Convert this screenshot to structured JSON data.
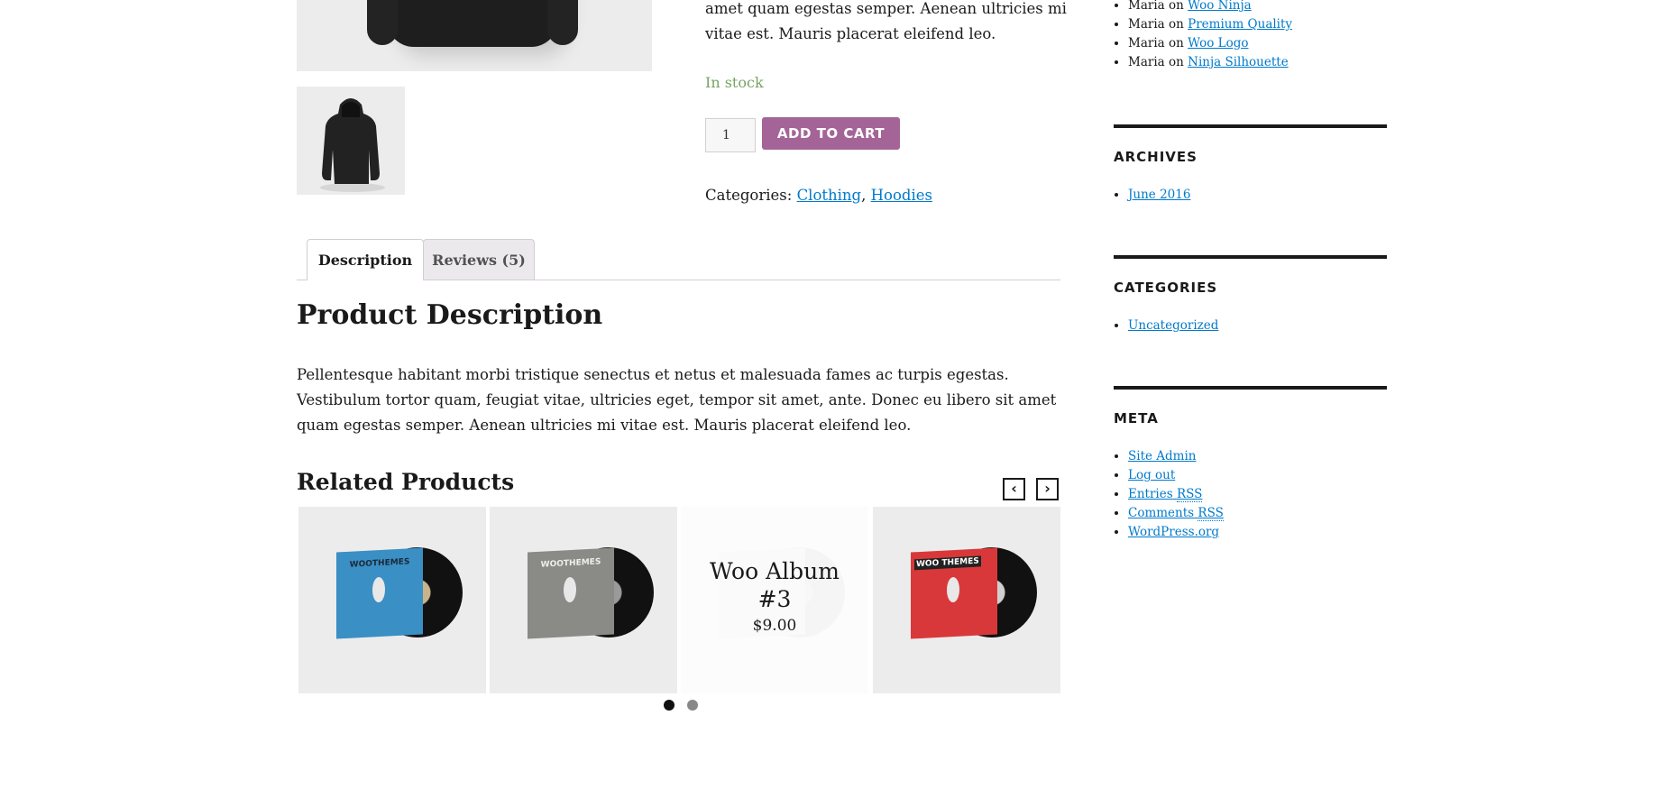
{
  "product": {
    "summary_line1": "amet quam egestas semper. Aenean ultricies mi",
    "summary_line2": "vitae est. Mauris placerat eleifend leo.",
    "stock": "In stock",
    "quantity": "1",
    "add_to_cart": "ADD TO CART",
    "categories_label": "Categories:",
    "categories": [
      "Clothing",
      "Hoodies"
    ],
    "categories_sep": ","
  },
  "tabs": [
    "Description",
    "Reviews (5)"
  ],
  "description": {
    "title": "Product Description",
    "body": "Pellentesque habitant morbi tristique senectus et netus et malesuada fames ac turpis egestas. Vestibulum tortor quam, feugiat vitae, ultricies eget, tempor sit amet, ante. Donec eu libero sit amet quam egestas semper. Aenean ultricies mi vitae est. Mauris placerat eleifend leo."
  },
  "related": {
    "title": "Related Products",
    "prev_icon": "chevron-left-icon",
    "next_icon": "chevron-right-icon",
    "prev_glyph": "‹",
    "next_glyph": "›",
    "hover_card": {
      "title_line1": "Woo Album",
      "title_line2": "#3",
      "price": "$9.00"
    },
    "sleeve_colors": [
      "#3a8fc4",
      "#8a8a86",
      "#f2f2f2",
      "#d9383a"
    ],
    "sleeve_labels": [
      "WOOTHEMES",
      "WOOTHEMES",
      "",
      "WOO THEMES"
    ]
  },
  "sidebar": {
    "recent_comments": [
      {
        "author": "Maria",
        "on": "on",
        "post": "Woo Ninja"
      },
      {
        "author": "Maria",
        "on": "on",
        "post": "Premium Quality"
      },
      {
        "author": "Maria",
        "on": "on",
        "post": "Woo Logo"
      },
      {
        "author": "Maria",
        "on": "on",
        "post": "Ninja Silhouette"
      }
    ],
    "archives_title": "ARCHIVES",
    "archives": [
      "June 2016"
    ],
    "categories_title": "CATEGORIES",
    "categories": [
      "Uncategorized"
    ],
    "meta_title": "META",
    "meta": {
      "site_admin": "Site Admin",
      "log_out": "Log out",
      "entries": "Entries",
      "comments": "Comments",
      "rss": "RSS",
      "wordpress": "WordPress.org"
    }
  },
  "colors": {
    "accent": "#a46497",
    "link": "#007acc",
    "in_stock": "#77a464"
  }
}
